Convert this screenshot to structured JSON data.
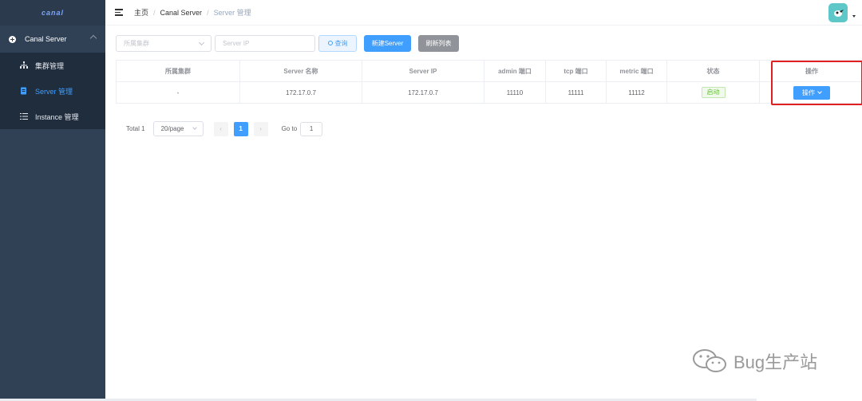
{
  "app": {
    "logo_text": "canal"
  },
  "sidebar": {
    "group_label": "Canal Server",
    "items": [
      {
        "label": "集群管理",
        "icon": "cluster-icon",
        "active": false
      },
      {
        "label": "Server 管理",
        "icon": "document-icon",
        "active": true
      },
      {
        "label": "Instance 管理",
        "icon": "list-icon",
        "active": false
      }
    ]
  },
  "breadcrumb": [
    "主页",
    "Canal Server",
    "Server 管理"
  ],
  "filters": {
    "cluster_placeholder": "所属集群",
    "ip_placeholder": "Server IP",
    "search_label": "查询",
    "new_label": "新建Server",
    "refresh_label": "刷新列表"
  },
  "table": {
    "columns": [
      "所属集群",
      "Server 名称",
      "Server IP",
      "admin 端口",
      "tcp 端口",
      "metric 端口",
      "状态",
      "操作"
    ],
    "rows": [
      {
        "cluster": "-",
        "name": "172.17.0.7",
        "ip": "172.17.0.7",
        "admin_port": "11110",
        "tcp_port": "11111",
        "metric_port": "11112",
        "status": "启动",
        "action": "操作"
      }
    ]
  },
  "pagination": {
    "total_label": "Total 1",
    "page_size": "20/page",
    "current_page": "1",
    "goto_label": "Go to",
    "goto_value": "1"
  },
  "watermark": {
    "text": "Bug生产站"
  },
  "colors": {
    "primary": "#409eff",
    "sidebar_bg": "#304156",
    "success": "#67c23a",
    "highlight": "#e02020"
  }
}
